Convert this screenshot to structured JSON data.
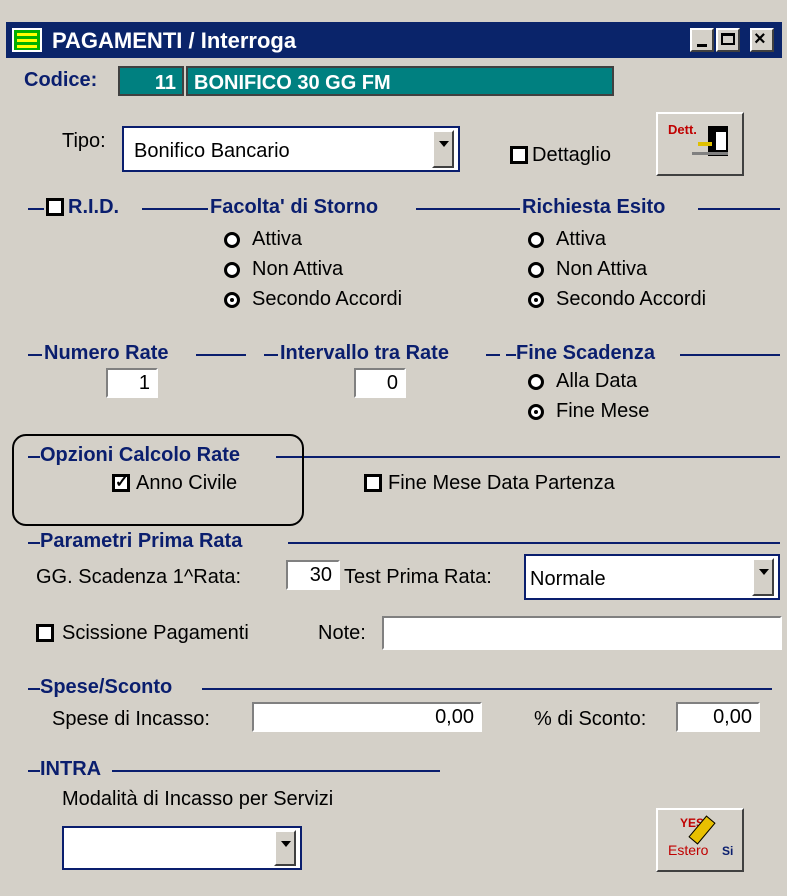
{
  "window": {
    "title": "PAGAMENTI / Interroga"
  },
  "codice": {
    "label": "Codice:",
    "number": "11",
    "description": "BONIFICO 30 GG FM"
  },
  "tipo": {
    "label": "Tipo:",
    "value": "Bonifico Bancario"
  },
  "dettaglio": {
    "label": "Dettaglio",
    "checked": false
  },
  "dett_button": {
    "label": "Dett."
  },
  "rid": {
    "label": "R.I.D.",
    "checked": false
  },
  "facolta_storno": {
    "title": "Facolta' di Storno",
    "options": [
      "Attiva",
      "Non Attiva",
      "Secondo Accordi"
    ],
    "selected": "Secondo Accordi"
  },
  "richiesta_esito": {
    "title": "Richiesta Esito",
    "options": [
      "Attiva",
      "Non Attiva",
      "Secondo Accordi"
    ],
    "selected": "Secondo Accordi"
  },
  "numero_rate": {
    "title": "Numero Rate",
    "value": "1"
  },
  "intervallo_rate": {
    "title": "Intervallo tra Rate",
    "value": "0"
  },
  "fine_scadenza": {
    "title": "Fine Scadenza",
    "options": [
      "Alla Data",
      "Fine Mese"
    ],
    "selected": "Fine Mese"
  },
  "opzioni_calcolo": {
    "title": "Opzioni Calcolo Rate",
    "anno_civile": {
      "label": "Anno Civile",
      "checked": true
    },
    "fine_mese_partenza": {
      "label": "Fine Mese Data Partenza",
      "checked": false
    }
  },
  "prima_rata": {
    "title": "Parametri Prima Rata",
    "gg_label": "GG. Scadenza 1^Rata:",
    "gg_value": "30",
    "test_label": "Test Prima Rata:",
    "test_value": "Normale"
  },
  "scissione": {
    "label": "Scissione Pagamenti",
    "checked": false
  },
  "note": {
    "label": "Note:",
    "value": ""
  },
  "spese_sconto": {
    "title": "Spese/Sconto",
    "spese_label": "Spese di Incasso:",
    "spese_value": "0,00",
    "sconto_label": "% di Sconto:",
    "sconto_value": "0,00"
  },
  "intra": {
    "title": "INTRA",
    "modalita_label": "Modalità di Incasso per Servizi",
    "modalita_value": ""
  },
  "estero_button": {
    "label": "Estero",
    "yes": "YES",
    "si": "Si"
  },
  "colors": {
    "title_bar": "#0a246a",
    "teal_field": "#008080",
    "section_text": "#0a1e6e",
    "face": "#d4d0c8"
  }
}
